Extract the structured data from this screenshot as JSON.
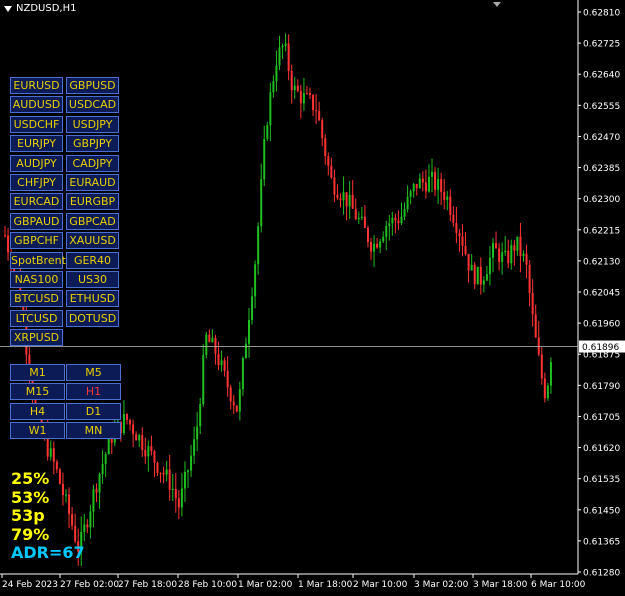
{
  "chart": {
    "title": "NZDUSD,H1",
    "current_price": "0.61896",
    "price_levels": [
      "0.62810",
      "0.62725",
      "0.62640",
      "0.62555",
      "0.62470",
      "0.62385",
      "0.62300",
      "0.62215",
      "0.62130",
      "0.62045",
      "0.61960",
      "0.61875",
      "0.61790",
      "0.61705",
      "0.61620",
      "0.61535",
      "0.61450",
      "0.61365",
      "0.61280"
    ],
    "time_labels": [
      "24 Feb 2023",
      "27 Feb 02:00",
      "27 Feb 18:00",
      "28 Feb 10:00",
      "1 Mar 02:00",
      "1 Mar 18:00",
      "2 Mar 10:00",
      "3 Mar 02:00",
      "3 Mar 18:00",
      "6 Mar 10:00"
    ],
    "colors": {
      "bull": "#1fbf1f",
      "bear": "#ff3333",
      "axis": "#ffffff",
      "background": "#000000",
      "price_line": "#c0c0c0"
    }
  },
  "symbols": [
    [
      "EURUSD",
      "GBPUSD"
    ],
    [
      "AUDUSD",
      "USDCAD"
    ],
    [
      "USDCHF",
      "USDJPY"
    ],
    [
      "EURJPY",
      "GBPJPY"
    ],
    [
      "AUDJPY",
      "CADJPY"
    ],
    [
      "CHFJPY",
      "EURAUD"
    ],
    [
      "EURCAD",
      "EURGBP"
    ],
    [
      "GBPAUD",
      "GBPCAD"
    ],
    [
      "GBPCHF",
      "XAUUSD"
    ],
    [
      "SpotBrent",
      "GER40"
    ],
    [
      "NAS100",
      "US30"
    ],
    [
      "BTCUSD",
      "ETHUSD"
    ],
    [
      "LTCUSD",
      "DOTUSD"
    ],
    [
      "XRPUSD"
    ]
  ],
  "timeframes": [
    [
      "M1",
      "M5"
    ],
    [
      "M15",
      "H1"
    ],
    [
      "H4",
      "D1"
    ],
    [
      "W1",
      "MN"
    ]
  ],
  "active_timeframe": "H1",
  "stats": {
    "line1": "25%",
    "line2": "53%",
    "line3": "53p",
    "line4": "79%",
    "adr": "ADR=67"
  },
  "icons": {
    "menu": "triangle-down-icon",
    "scroll": "shift-arrow-icon"
  }
}
